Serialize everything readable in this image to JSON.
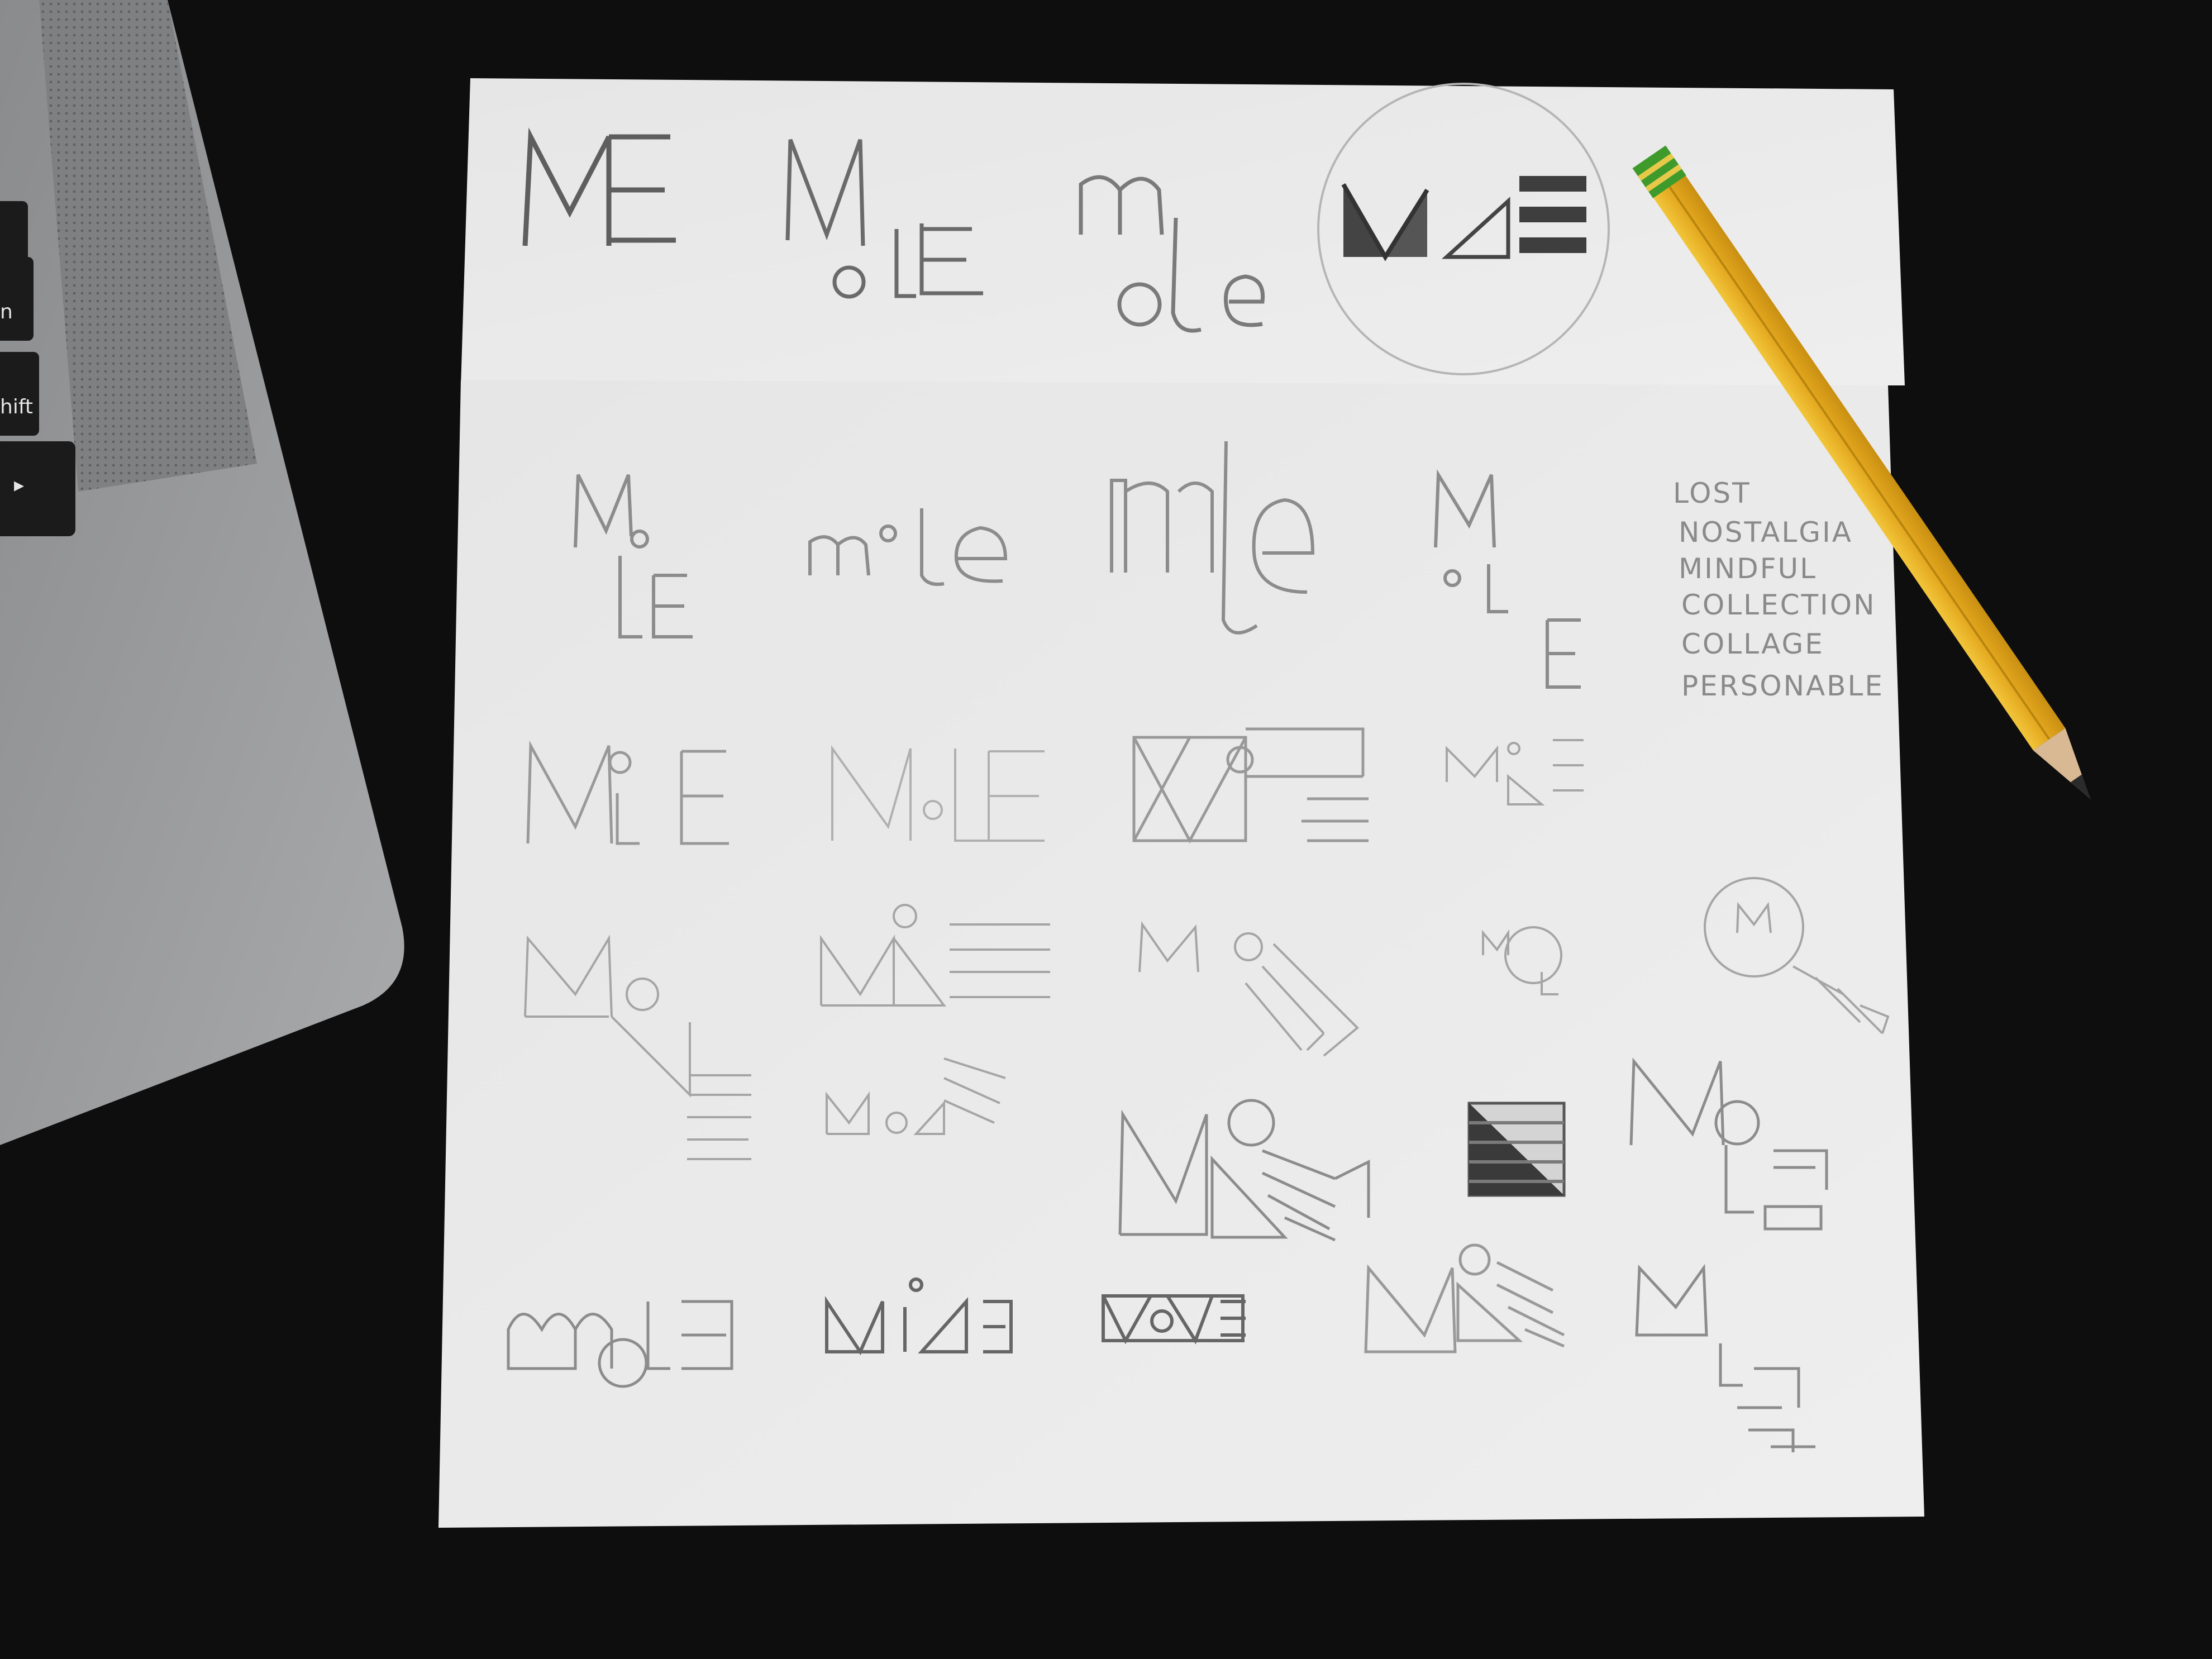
{
  "laptop": {
    "key_label_1": "n",
    "key_label_2": "hift",
    "key_label_3": "▸"
  },
  "sketches": {
    "top_sheet_marks": [
      "ME",
      "Mole",
      "mole",
      "MoE"
    ],
    "bottom_sheet_marks": [
      "MoLE",
      "mole",
      "mle",
      "MoLE"
    ]
  },
  "word_list": [
    "LOST",
    "NOSTALGIA",
    "MINDFUL",
    "COLLECTION",
    "COLLAGE",
    "PERSONABLE"
  ],
  "colors": {
    "desk": "#0e0e0f",
    "paper": "#ebebeb",
    "pencil_body": "#e8b72a",
    "pencil_ferrule": "#3f9a2c",
    "graphite": "#6d6d6d"
  }
}
